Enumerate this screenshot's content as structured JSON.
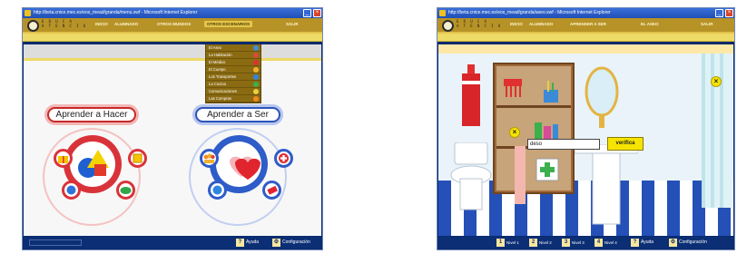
{
  "colors": {
    "window_frame": "#0a2a6b",
    "titlebar_blue": "#1f4fb6",
    "navbar_gold": "#b79327",
    "strip_yellow": "#eeda66",
    "hacer_red": "#c62a2a",
    "ser_blue": "#2c54b8",
    "verify_yellow": "#f6e400",
    "floor_blue": "#2450b8"
  },
  "left_window": {
    "title": "http://beta.cnice.mec.es/eos_mead/granda/menu.swf - Microsoft Internet Explorer",
    "logo_text": "E D U C A\nA T E N C I O",
    "nav": {
      "inicio": "INICIO",
      "alumnado": "ALUMNADO",
      "otros_mundos": "OTROS MUNDOS",
      "otros_escenarios": "OTROS ESCENARIOS",
      "salir": "SALIR"
    },
    "dropdown_items": [
      {
        "label": "El Aseo",
        "icon": "soap-icon",
        "color": "#3f8fd8"
      },
      {
        "label": "La Habitación",
        "icon": "bed-icon",
        "color": "#d84a3a"
      },
      {
        "label": "El Médico",
        "icon": "medical-cross-icon",
        "color": "#e03030"
      },
      {
        "label": "El Cuerpo",
        "icon": "body-icon",
        "color": "#f0b030"
      },
      {
        "label": "Los Transportes",
        "icon": "car-icon",
        "color": "#2f86e0"
      },
      {
        "label": "La Cocina",
        "icon": "pot-icon",
        "color": "#3cb04c"
      },
      {
        "label": "Comunicaciones",
        "icon": "phone-icon",
        "color": "#e8d040"
      },
      {
        "label": "Las Compras",
        "icon": "shopping-icon",
        "color": "#f08a20"
      }
    ],
    "sections": {
      "hacer": "Aprender a Hacer",
      "ser": "Aprender a Ser"
    },
    "status": {
      "help_num": "?",
      "help_label": "Ayuda",
      "config_label": "Configuración"
    }
  },
  "right_window": {
    "title": "http://beta.cnice.mec.es/eos_mead/granda/aseo.swf - Microsoft Internet Explorer",
    "logo_text": "E D U C A\nA T E N C I O",
    "nav": {
      "inicio": "INICIO",
      "alumnado": "ALUMNADO",
      "aprender_ser": "APRENDER A SER",
      "el_aseo": "EL ASEO",
      "salir": "SALIR"
    },
    "exercise": {
      "input_value": "deso",
      "verify_label": "verifica",
      "close_symbol": "×"
    },
    "levels": [
      {
        "num": "1",
        "label": "Nivel 1"
      },
      {
        "num": "2",
        "label": "Nivel 2"
      },
      {
        "num": "3",
        "label": "Nivel 3"
      },
      {
        "num": "4",
        "label": "Nivel 4"
      }
    ],
    "status": {
      "help_num": "?",
      "help_label": "Ayuda",
      "config_label": "Configuración"
    }
  }
}
